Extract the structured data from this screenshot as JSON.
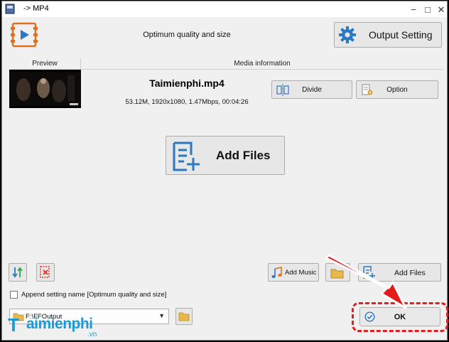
{
  "window": {
    "title": "-> MP4",
    "minimize_glyph": "−",
    "maximize_glyph": "□",
    "close_glyph": "✕"
  },
  "header": {
    "profile_text": "Optimum quality and size",
    "output_setting_label": "Output Setting"
  },
  "file_list": {
    "columns": [
      "Preview",
      "Media information"
    ],
    "items": [
      {
        "name": "Taimienphi.mp4",
        "meta": "53.12M, 1920x1080, 1.47Mbps, 00:04:26",
        "divide_label": "Divide",
        "option_label": "Option"
      }
    ]
  },
  "main": {
    "add_files_label": "Add Files"
  },
  "toolbar": {
    "add_music_label": "Add Music",
    "add_files_label": "Add Files"
  },
  "append_setting": {
    "label": "Append setting name [Optimum quality and size]",
    "checked": false
  },
  "output": {
    "path": "F:\\FFOutput"
  },
  "ok_label": "OK",
  "watermark": {
    "brand": "aimienphi",
    "brand_initial": "T",
    "suffix": ".vn"
  },
  "colors": {
    "accent_blue": "#2b78c5",
    "highlight_red": "#e02020",
    "watermark_blue": "#1a9ad6"
  }
}
